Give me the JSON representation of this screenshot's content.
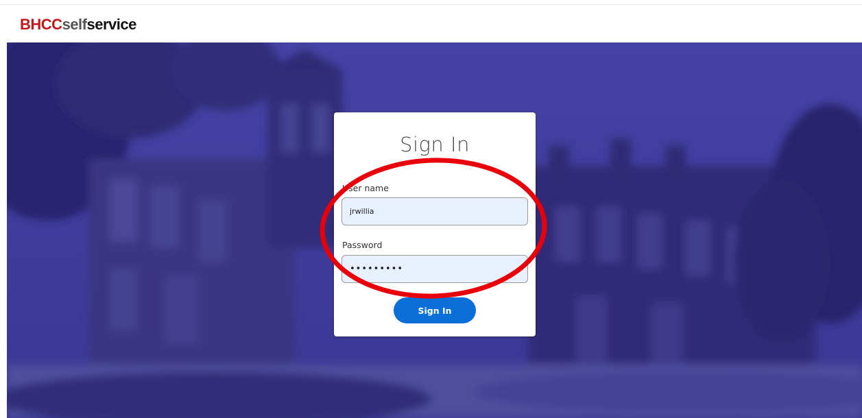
{
  "header": {
    "logo_part1": "BHCC",
    "logo_part2": "self",
    "logo_part3": "service"
  },
  "signin": {
    "title": "Sign In",
    "username_label": "User name",
    "username_value": "jrwillia",
    "password_label": "Password",
    "password_value": "•••••••••",
    "button_label": "Sign In"
  },
  "colors": {
    "brand_red": "#c4161c",
    "hero_overlay": "#3d3a8e",
    "button_blue": "#0b6fd9",
    "input_fill": "#e8f0fe",
    "annotation_red": "#e8000b"
  }
}
